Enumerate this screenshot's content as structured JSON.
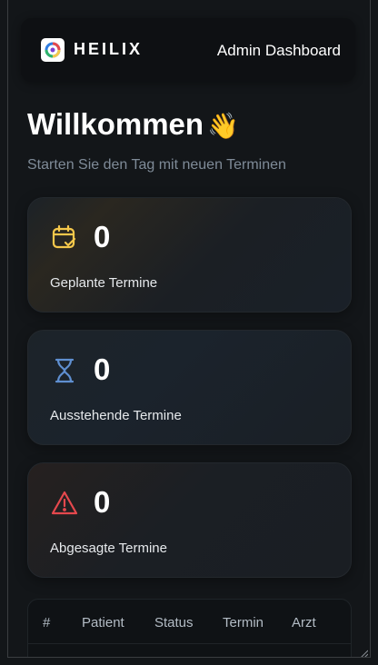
{
  "header": {
    "brand": "HEILIX",
    "title": "Admin Dashboard"
  },
  "welcome": {
    "title": "Willkommen",
    "emoji": "👋",
    "subtitle": "Starten Sie den Tag mit neuen Terminen"
  },
  "stats": [
    {
      "icon": "calendar-check-icon",
      "count": "0",
      "label": "Geplante Termine",
      "color": "#f5c84b"
    },
    {
      "icon": "hourglass-icon",
      "count": "0",
      "label": "Ausstehende Termine",
      "color": "#5f8fd0"
    },
    {
      "icon": "warning-icon",
      "count": "0",
      "label": "Abgesagte Termine",
      "color": "#e5484d"
    }
  ],
  "table": {
    "columns": [
      "#",
      "Patient",
      "Status",
      "Termin",
      "Arzt"
    ]
  }
}
